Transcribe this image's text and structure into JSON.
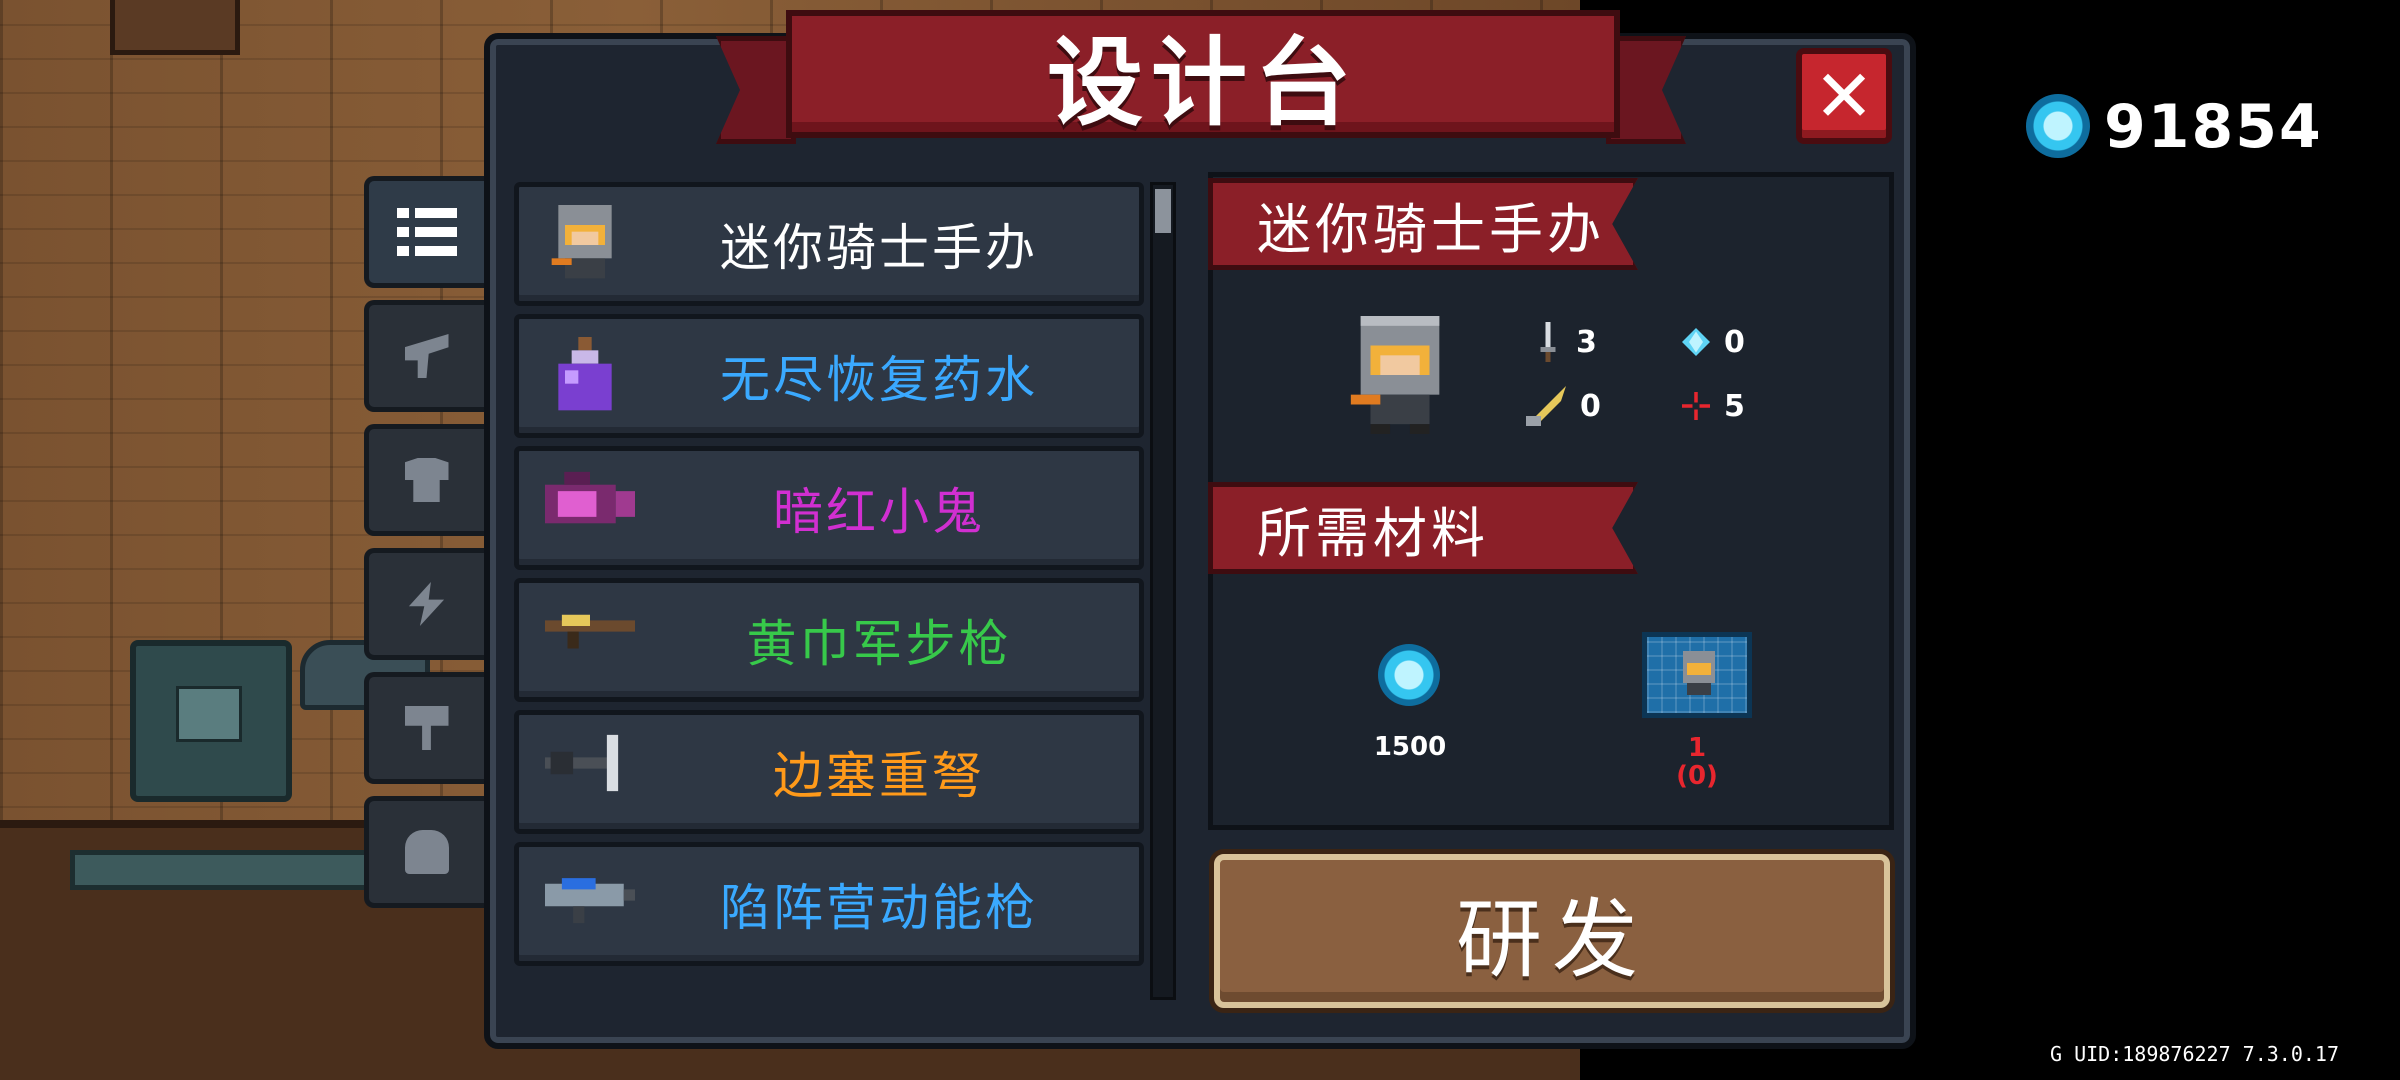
{
  "title": "设计台",
  "close_label": "✕",
  "side_tabs": [
    {
      "name": "list",
      "active": true
    },
    {
      "name": "weapon",
      "active": false
    },
    {
      "name": "armor",
      "active": false
    },
    {
      "name": "skill",
      "active": false
    },
    {
      "name": "pet",
      "active": false
    },
    {
      "name": "character",
      "active": false
    }
  ],
  "items": [
    {
      "label": "迷你骑士手办",
      "color": "#ffffff",
      "icon": "mini-knight-figure"
    },
    {
      "label": "无尽恢复药水",
      "color": "#3aa9ff",
      "icon": "purple-potion"
    },
    {
      "label": "暗红小鬼",
      "color": "#d12fd1",
      "icon": "pink-camera-gun"
    },
    {
      "label": "黄巾军步枪",
      "color": "#37c94a",
      "icon": "yellow-rifle"
    },
    {
      "label": "边塞重弩",
      "color": "#ff9a1a",
      "icon": "heavy-crossbow"
    },
    {
      "label": "陷阵营动能枪",
      "color": "#3aa9ff",
      "icon": "kinetic-gun"
    }
  ],
  "detail": {
    "name": "迷你骑士手办",
    "stats": {
      "attack": "3",
      "energy": "0",
      "crit_speed": "0",
      "accuracy": "5"
    },
    "materials_header": "所需材料",
    "materials": [
      {
        "icon": "gem",
        "amount": "1500"
      },
      {
        "icon": "blueprint",
        "amount": "1",
        "owned": "(0)"
      }
    ],
    "research_label": "研发"
  },
  "currency": {
    "gems": "91854"
  },
  "uid_text": "G UID:189876227 7.3.0.17"
}
